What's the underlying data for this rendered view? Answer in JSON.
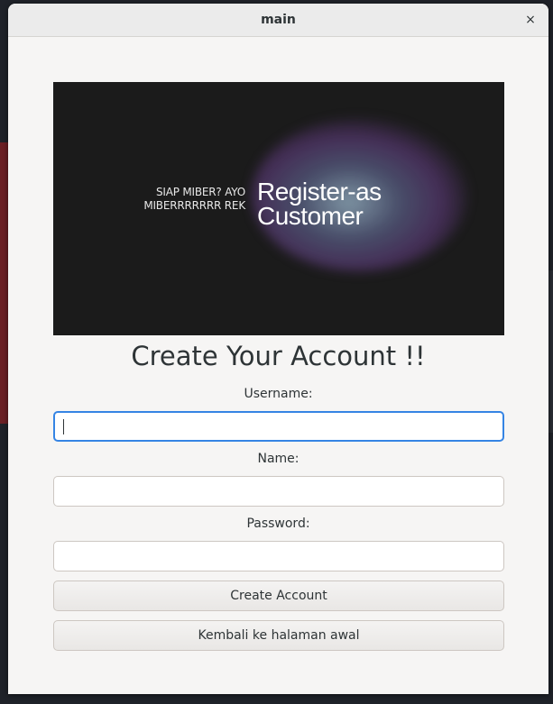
{
  "window": {
    "title": "main",
    "close_glyph": "×"
  },
  "banner": {
    "tagline": "SIAP MIBER? AYO\nMIBERRRRRRR REK",
    "headline": "Register-as\nCustomer",
    "background_color": "#1b1b1b"
  },
  "form": {
    "heading": "Create Your Account !!",
    "fields": [
      {
        "label": "Username:",
        "value": "",
        "focused": true
      },
      {
        "label": "Name:",
        "value": "",
        "focused": false
      },
      {
        "label": "Password:",
        "value": "",
        "focused": false
      }
    ],
    "create_button_label": "Create Account",
    "back_button_label": "Kembali ke halaman awal"
  },
  "colors": {
    "focus_accent": "#3584e4",
    "window_bg": "#f6f5f4"
  },
  "icons": {
    "close": "close-icon"
  }
}
